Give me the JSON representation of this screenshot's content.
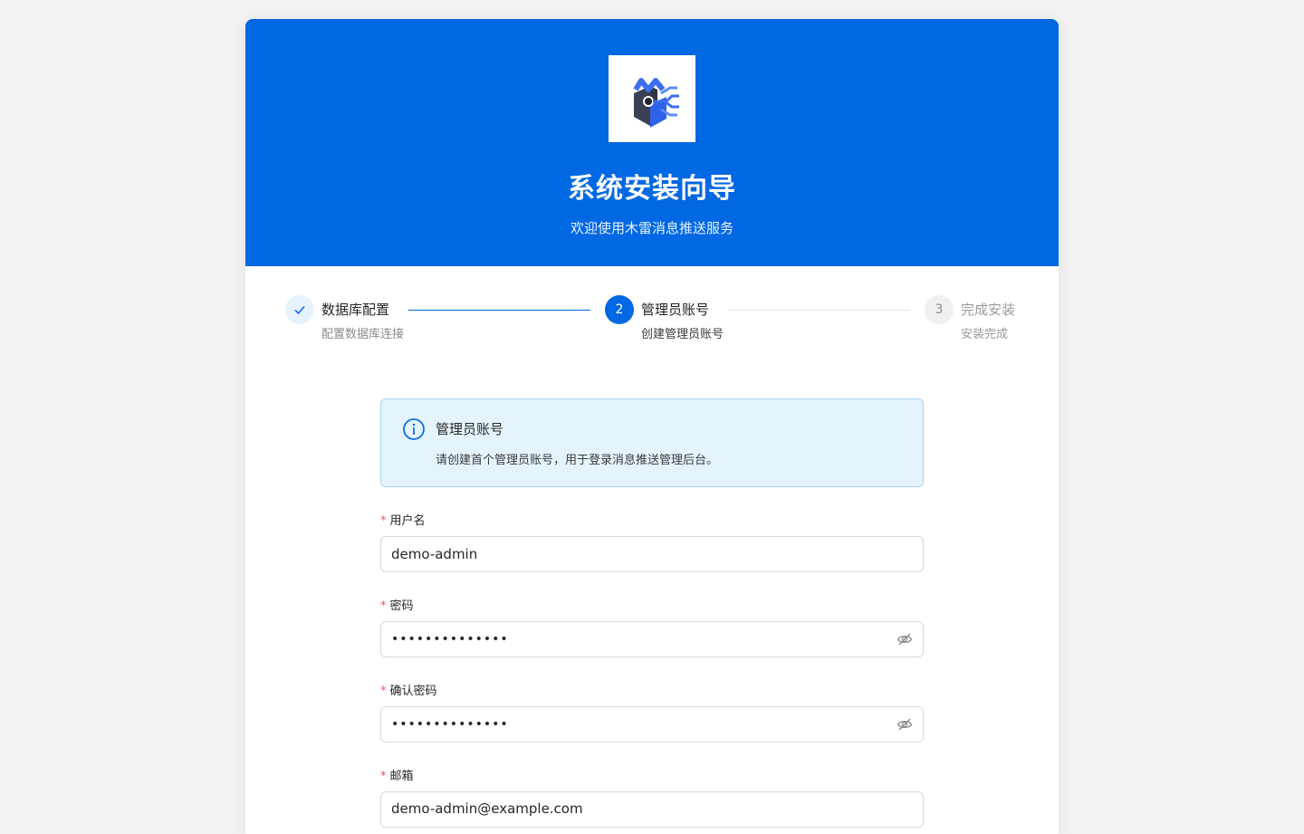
{
  "header": {
    "title": "系统安装向导",
    "subtitle": "欢迎使用木雷消息推送服务",
    "primary_color": "#0068e3"
  },
  "steps": [
    {
      "status": "done",
      "number": "",
      "title": "数据库配置",
      "description": "配置数据库连接"
    },
    {
      "status": "active",
      "number": "2",
      "title": "管理员账号",
      "description": "创建管理员账号"
    },
    {
      "status": "wait",
      "number": "3",
      "title": "完成安装",
      "description": "安装完成"
    }
  ],
  "alert": {
    "title": "管理员账号",
    "description": "请创建首个管理员账号，用于登录消息推送管理后台。"
  },
  "form": {
    "required_mark": "*",
    "username": {
      "label": "用户名",
      "value": "demo-admin"
    },
    "password": {
      "label": "密码",
      "value": "••••••••••••••"
    },
    "confirm_password": {
      "label": "确认密码",
      "value": "••••••••••••••"
    },
    "email": {
      "label": "邮箱",
      "value": "demo-admin@example.com"
    }
  }
}
